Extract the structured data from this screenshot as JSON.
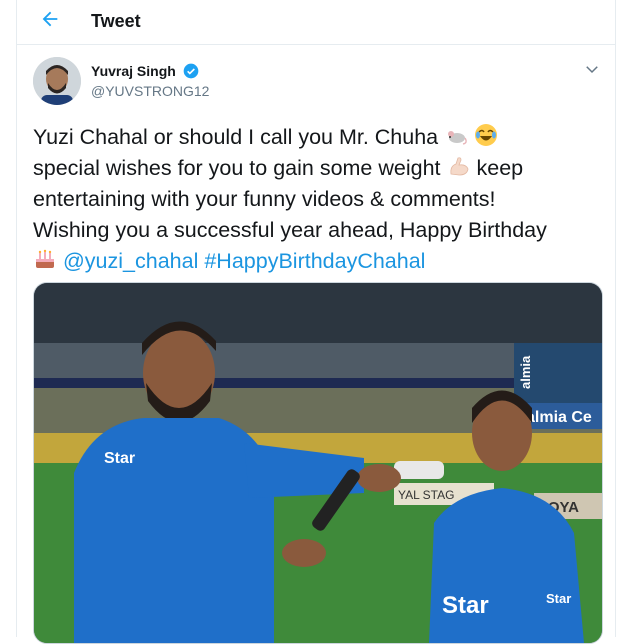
{
  "header": {
    "title": "Tweet"
  },
  "author": {
    "name": "Yuvraj Singh",
    "handle": "@YUVSTRONG12"
  },
  "tweet": {
    "line1": "Yuzi Chahal or should I call you Mr. Chuha",
    "line2": "special wishes for you to gain some weight",
    "line2b": "keep",
    "line3": "entertaining with your funny videos & comments!",
    "line4": "Wishing you a successful year ahead, Happy Birthday",
    "mention": "@yuzi_chahal",
    "hashtag": "#HappyBirthdayChahal"
  },
  "media": {
    "stadium_texts": [
      "almia",
      "almia Ce",
      "ROYA",
      "YAL STAG",
      "Star",
      "Star",
      "Star"
    ]
  },
  "icons": [
    "back-arrow-icon",
    "verified-badge-icon",
    "chevron-down-icon",
    "mouse-emoji-icon",
    "laughing-emoji-icon",
    "flexed-biceps-emoji-icon",
    "birthday-cake-emoji-icon"
  ],
  "colors": {
    "accent": "#1da1f2",
    "link": "#1b95e0",
    "text": "#14171a",
    "muted": "#657786",
    "border": "#e6ecf0"
  }
}
